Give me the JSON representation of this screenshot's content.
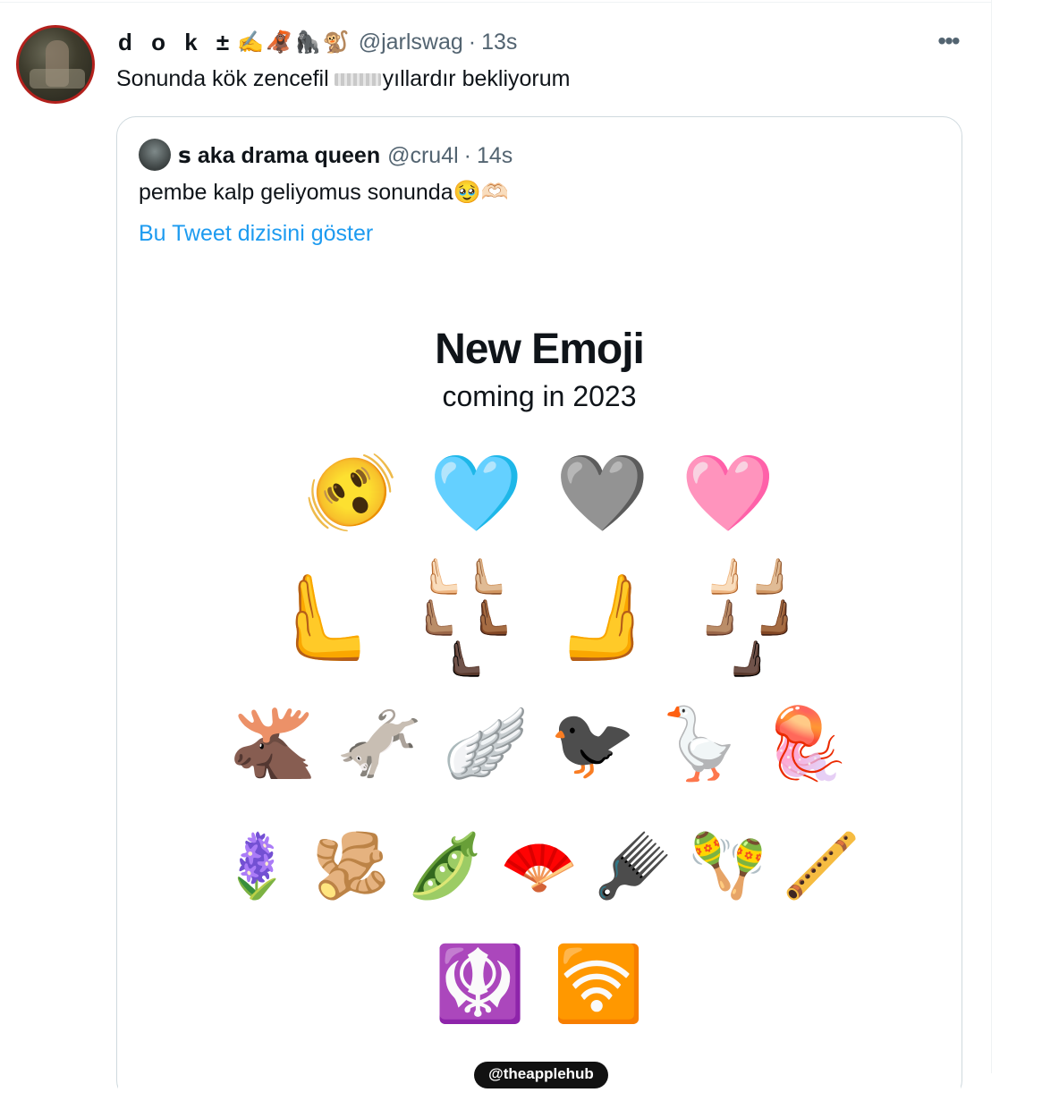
{
  "tweet": {
    "display_name": "d o k ±",
    "name_emojis": "✍️🦧🦍🐒",
    "handle": "@jarlswag",
    "separator": "·",
    "time": "13s",
    "more_label": "•••",
    "text_before": "Sonunda kök zencefil",
    "text_after": "yıllardır bekliyorum"
  },
  "quote": {
    "display_name": "ꜱ aka drama queen",
    "handle": "@cru4l",
    "separator": "·",
    "time": "14s",
    "text": "pembe kalp geliyomus sonunda🥹🫶🏻",
    "thread_link": "Bu Tweet dizisini göster"
  },
  "media": {
    "title": "New Emoji",
    "subtitle": "coming in 2023",
    "row1": [
      {
        "glyph": "🫨",
        "icon": "shaking-face-icon"
      },
      {
        "glyph": "🩵",
        "icon": "light-blue-heart-icon"
      },
      {
        "glyph": "🩶",
        "icon": "grey-heart-icon"
      },
      {
        "glyph": "🩷",
        "icon": "pink-heart-icon"
      }
    ],
    "row2": [
      {
        "glyph": "🫷",
        "icon": "leftwards-pushing-hand-icon"
      },
      {
        "glyph": "🫷🏻🫷🏼🫷🏽 🫷🏾🫷🏿",
        "icon": "leftwards-pushing-hand-skin-tones-icon"
      },
      {
        "glyph": "🫸",
        "icon": "rightwards-pushing-hand-icon"
      },
      {
        "glyph": "🫸🏻🫸🏼🫸🏽 🫸🏾🫸🏿",
        "icon": "rightwards-pushing-hand-skin-tones-icon"
      }
    ],
    "row3": [
      {
        "glyph": "🫎",
        "icon": "moose-icon"
      },
      {
        "glyph": "🫏",
        "icon": "donkey-icon"
      },
      {
        "glyph": "🪽",
        "icon": "wing-icon"
      },
      {
        "glyph": "🐦‍⬛",
        "icon": "black-bird-icon"
      },
      {
        "glyph": "🪿",
        "icon": "goose-icon"
      },
      {
        "glyph": "🪼",
        "icon": "jellyfish-icon"
      }
    ],
    "row4": [
      {
        "glyph": "🪻",
        "icon": "hyacinth-icon"
      },
      {
        "glyph": "🫚",
        "icon": "ginger-root-icon"
      },
      {
        "glyph": "🫛",
        "icon": "pea-pod-icon"
      },
      {
        "glyph": "🪭",
        "icon": "folding-hand-fan-icon"
      },
      {
        "glyph": "🪮",
        "icon": "hair-pick-icon"
      },
      {
        "glyph": "🪇",
        "icon": "maracas-icon"
      },
      {
        "glyph": "🪈",
        "icon": "flute-icon"
      }
    ],
    "row5": [
      {
        "glyph": "🪯",
        "icon": "khanda-icon"
      },
      {
        "glyph": "🛜",
        "icon": "wireless-icon"
      }
    ],
    "watermark": "@theapplehub"
  }
}
